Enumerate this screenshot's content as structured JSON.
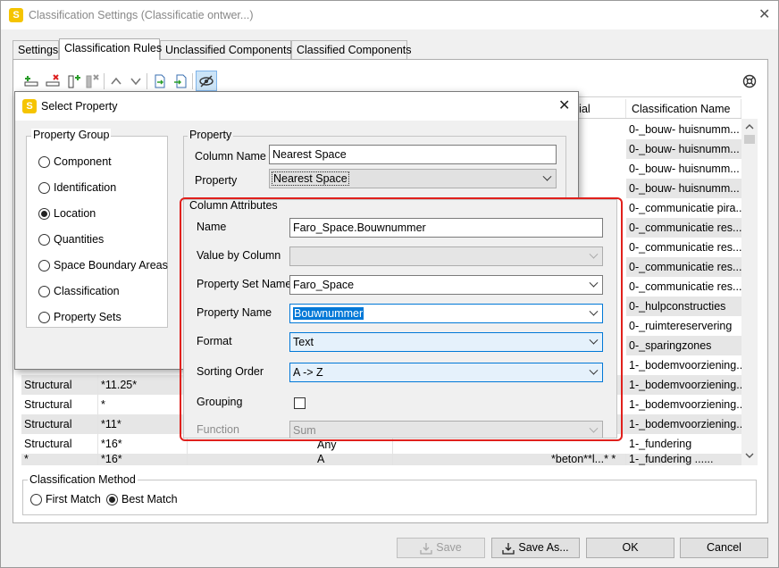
{
  "window": {
    "title": "Classification Settings (Classificatie ontwer...)",
    "app_icon": "S"
  },
  "tabs": [
    "Settings",
    "Classification Rules",
    "Unclassified Components",
    "Classified Components"
  ],
  "table": {
    "visible_headers": {
      "material_partial": "rial",
      "classification_name": "Classification Name"
    },
    "classification_names": [
      "0-_bouw- huisnumm...",
      "0-_bouw- huisnumm...",
      "0-_bouw- huisnumm...",
      "0-_bouw- huisnumm...",
      "0-_communicatie pira...",
      "0-_communicatie res...",
      "0-_communicatie res...",
      "0-_communicatie res...",
      "0-_communicatie res...",
      "0-_hulpconstructies",
      "0-_ruimtereservering",
      "0-_sparingzones",
      "1-_bodemvoorziening...",
      "1-_bodemvoorziening...",
      "1-_bodemvoorziening...",
      "1-_bodemvoorziening...",
      "1-_fundering",
      "1-_fundering ......"
    ],
    "bottom_rows": [
      {
        "type": "Structural",
        "code": "*11.25*",
        "extra": ""
      },
      {
        "type": "Structural",
        "code": "*",
        "extra": ""
      },
      {
        "type": "Structural",
        "code": "*11*",
        "extra": ""
      },
      {
        "type": "Structural",
        "code": "*16*",
        "extra": "Any"
      },
      {
        "type": "*",
        "code": "*16*",
        "extra": "A"
      }
    ],
    "partial_row_text": "*beton**l...* *"
  },
  "classification_method": {
    "title": "Classification Method",
    "options": [
      "First Match",
      "Best Match"
    ],
    "selected": "Best Match"
  },
  "buttons": {
    "save": "Save",
    "save_as": "Save As...",
    "ok": "OK",
    "cancel": "Cancel"
  },
  "dialog": {
    "title": "Select Property",
    "app_icon": "S",
    "property_group": {
      "title": "Property Group",
      "options": [
        "Component",
        "Identification",
        "Location",
        "Quantities",
        "Space Boundary Areas",
        "Classification",
        "Property Sets"
      ],
      "selected": "Location"
    },
    "property": {
      "title": "Property",
      "column_name_label": "Column Name",
      "column_name_value": "Nearest Space",
      "property_label": "Property",
      "property_value": "Nearest Space"
    },
    "column_attributes": {
      "title": "Column Attributes",
      "name_label": "Name",
      "name_value": "Faro_Space.Bouwnummer",
      "value_by_column_label": "Value by Column",
      "value_by_column_value": "",
      "property_set_name_label": "Property Set Name",
      "property_set_name_value": "Faro_Space",
      "property_name_label": "Property Name",
      "property_name_value": "Bouwnummer",
      "format_label": "Format",
      "format_value": "Text",
      "sorting_order_label": "Sorting Order",
      "sorting_order_value": "A -> Z",
      "grouping_label": "Grouping",
      "grouping_checked": false,
      "function_label": "Function",
      "function_value": "Sum"
    }
  },
  "colors": {
    "highlight_outline": "#e0201c",
    "selection": "#0078d7",
    "brand": "#f5c400"
  }
}
